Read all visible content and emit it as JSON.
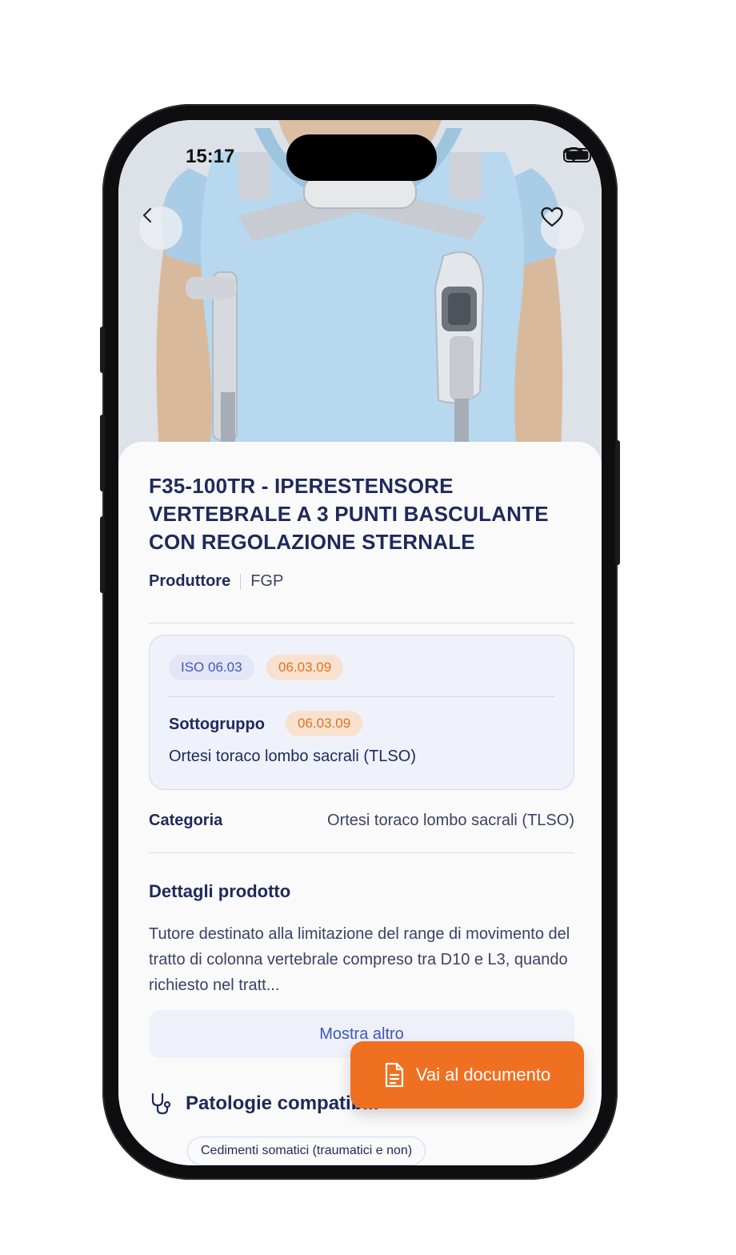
{
  "status_bar": {
    "time": "15:17",
    "icons": [
      "wifi-icon",
      "battery-icon"
    ]
  },
  "header": {
    "back_icon": "chevron-left-icon",
    "favorite_icon": "heart-icon"
  },
  "product": {
    "title": "F35-100TR - IPERESTENSORE VERTEBRALE A 3 PUNTI BASCULANTE CON REGOLAZIONE STERNALE",
    "manufacturer_label": "Produttore",
    "manufacturer_value": "FGP"
  },
  "iso": {
    "tag_iso": "ISO 06.03",
    "tag_code": "06.03.09",
    "subgroup_label": "Sottogruppo",
    "subgroup_code": "06.03.09",
    "subgroup_description": "Ortesi toraco lombo sacrali (TLSO)"
  },
  "category": {
    "label": "Categoria",
    "value": "Ortesi toraco lombo sacrali (TLSO)"
  },
  "details": {
    "title": "Dettagli prodotto",
    "text": "Tutore destinato alla limitazione del range di movimento del tratto di colonna vertebrale compreso tra D10 e L3, quando richiesto nel tratt...",
    "show_more": "Mostra altro"
  },
  "pathologies": {
    "icon": "stethoscope-icon",
    "title": "Patologie compatibili",
    "chips": [
      "Cedimenti somatici (traumatici e non)"
    ]
  },
  "fab": {
    "icon": "document-icon",
    "label": "Vai al documento"
  },
  "colors": {
    "primary_text": "#1e2a5a",
    "accent": "#ef7021",
    "link": "#4256b8",
    "card_bg": "#eff1fb"
  }
}
